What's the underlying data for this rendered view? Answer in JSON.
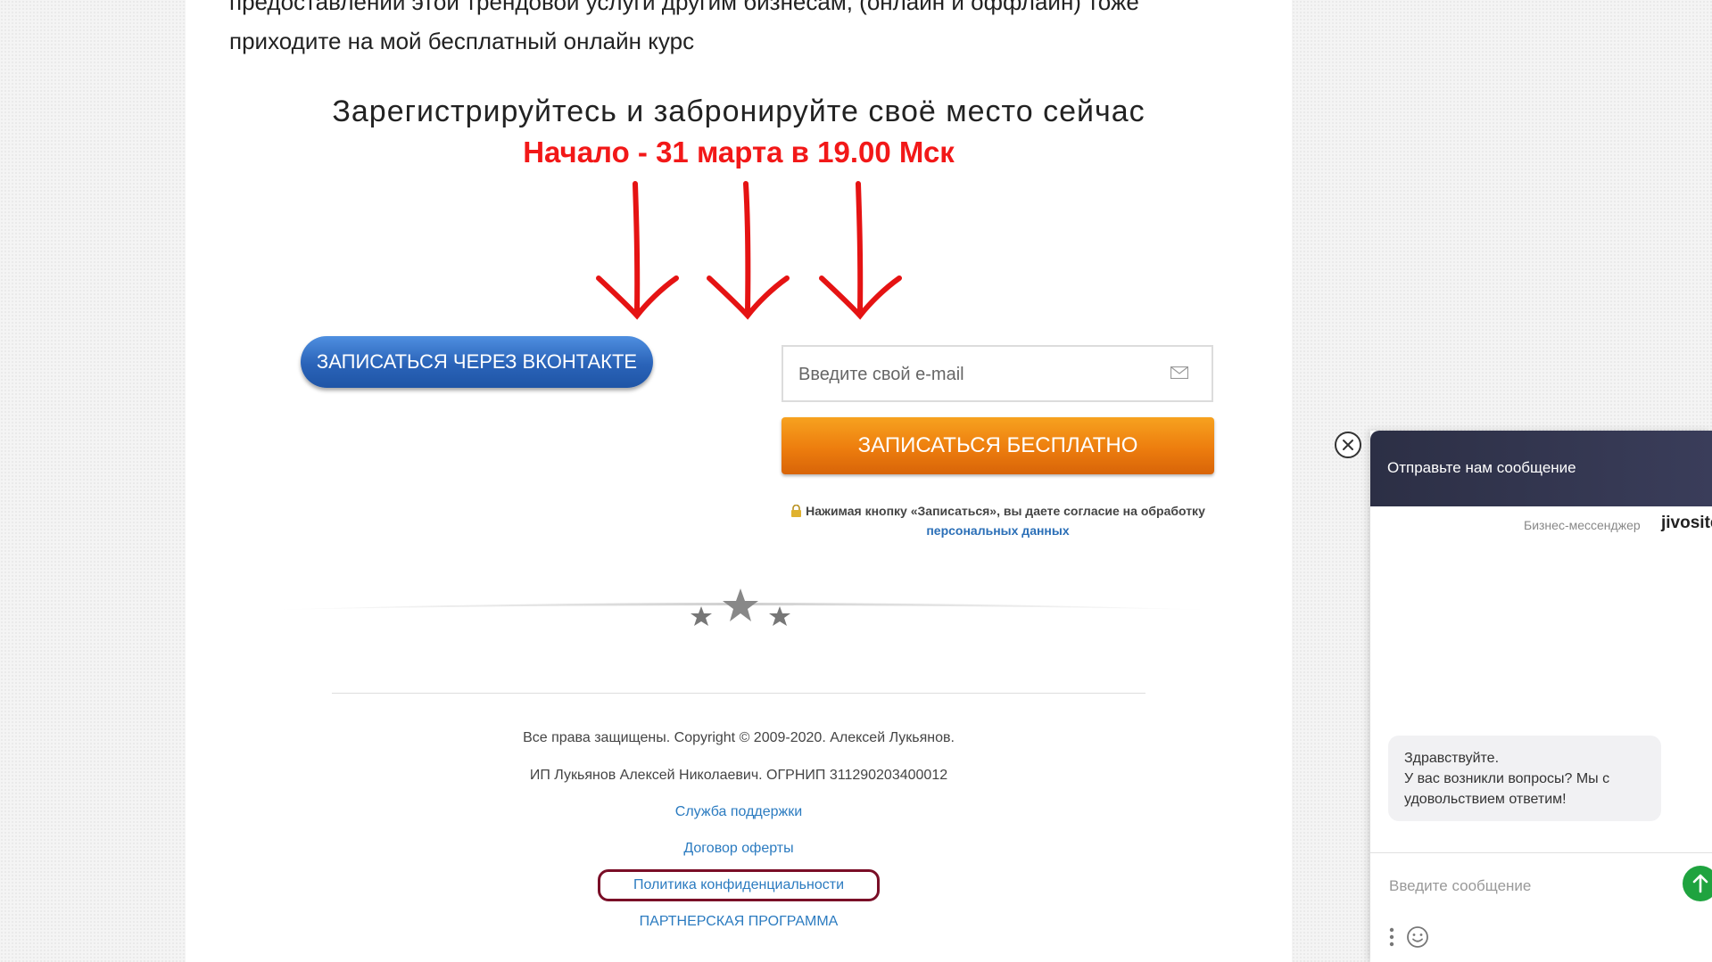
{
  "intro": {
    "line1": "предоставлении этой трендовой услуги другим бизнесам, (онлайн и оффлайн) тоже",
    "line2": "приходите на мой бесплатный онлайн курс"
  },
  "registration": {
    "headline": "Зарегистрируйтесь и забронируйте своё место сейчас",
    "start_text": "Начало - 31 марта в 19.00 Мск",
    "vk_button_label": "ЗАПИСАТЬСЯ ЧЕРЕЗ ВКОНТАКТЕ",
    "email_placeholder": "Введите свой e-mail",
    "submit_label": "ЗАПИСАТЬСЯ БЕСПЛАТНО",
    "consent_text": "Нажимая кнопку «Записаться», вы даете согласие на обработку",
    "consent_link": "персональных данных"
  },
  "footer": {
    "copyright": "Все права защищены. Copyright © 2009-2020. Алексей Лукьянов.",
    "legal": "ИП Лукьянов Алексей Николаевич. ОГРНИП 311290203400012",
    "links": [
      "Служба поддержки",
      "Договор оферты",
      "Политика конфиденциальности",
      "ПАРТНЕРСКАЯ ПРОГРАММА"
    ]
  },
  "chat": {
    "header_title": "Отправьте нам сообщение",
    "brand_label": "Бизнес-мессенджер",
    "brand_logo": "jivosite",
    "greeting_line1": "Здравствуйте.",
    "greeting_line2": "У вас возникли вопросы? Мы с",
    "greeting_line3": "удовольствием ответим!",
    "input_placeholder": "Введите сообщение"
  },
  "colors": {
    "accent_red": "#f21818",
    "vk_blue": "#2a63b8",
    "orange": "#ed7d0e",
    "link_blue": "#2b7bc0",
    "chat_header": "#2c2f45",
    "send_green": "#1fa33f",
    "highlight_box": "#7a0e27"
  },
  "icons": [
    "mail-icon",
    "lock-icon",
    "stars-divider-icon",
    "close-icon",
    "send-arrow-icon",
    "menu-dots-icon",
    "emoji-icon",
    "down-arrow-icon"
  ]
}
